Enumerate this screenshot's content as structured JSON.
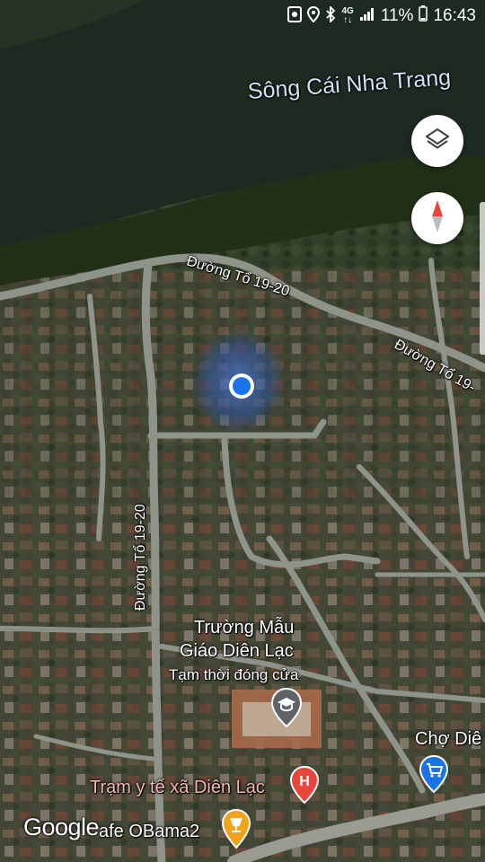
{
  "status_bar": {
    "network": "4G",
    "network_sub": "↑↓",
    "battery": "11%",
    "time": "16:43",
    "icons": [
      "screenshot-icon",
      "location-icon",
      "bluetooth-icon",
      "signal-icon"
    ]
  },
  "map": {
    "river_label": "Sông Cái Nha Trang",
    "roads": [
      "Đường Tổ 19-20",
      "Đường Tổ 19-",
      "Đường Tổ 19-20"
    ],
    "places": {
      "school_name_line1": "Trường Mẫu",
      "school_name_line2": "Giáo Diên Lạc",
      "school_status": "Tạm thời đóng cửa",
      "health_station": "Trạm y tế xã Diên Lạc",
      "market": "Chợ Diê",
      "cafe": "afe OBama2"
    }
  },
  "controls": {
    "layers_icon": "layers-icon",
    "compass_icon": "compass-icon"
  },
  "branding": {
    "logo": "Google"
  },
  "colors": {
    "river": "#1d2a22",
    "location_dot": "#1a73e8",
    "hospital_pin": "#e8453c",
    "market_pin": "#1a73e8",
    "cafe_pin": "#f2a31b",
    "school_pin": "#5f6368"
  }
}
